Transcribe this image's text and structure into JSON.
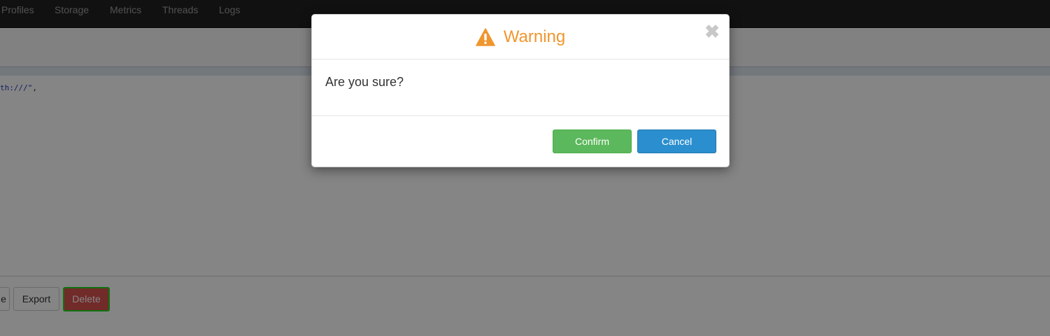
{
  "navbar": {
    "items": [
      "Profiles",
      "Storage",
      "Metrics",
      "Threads",
      "Logs"
    ]
  },
  "code": {
    "fragment": "th:///\"",
    "punct": ","
  },
  "toolbar": {
    "clipped_label": "e",
    "export_label": "Export",
    "delete_label": "Delete"
  },
  "modal": {
    "title": "Warning",
    "message": "Are you sure?",
    "close_glyph": "✖",
    "confirm_label": "Confirm",
    "cancel_label": "Cancel"
  },
  "colors": {
    "warning": "#f0962e",
    "confirm": "#5cb85c",
    "cancel": "#2b8fcf",
    "delete": "#d9534f",
    "focus_outline": "#22dd22"
  },
  "icons": {
    "title_icon": "warning-triangle-icon",
    "close_icon": "close-icon"
  }
}
